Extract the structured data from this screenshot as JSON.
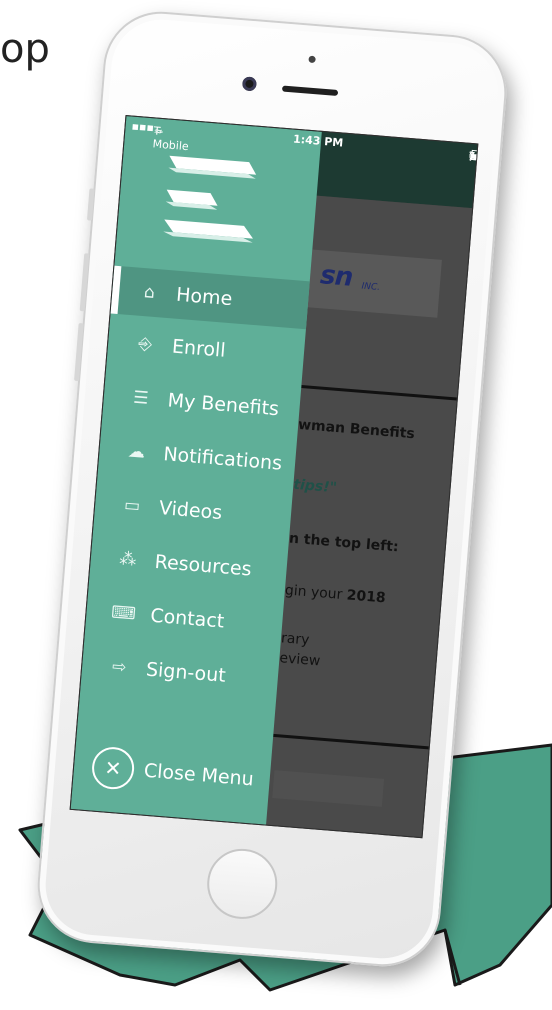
{
  "background": {
    "cropped_text": "op"
  },
  "status_bar": {
    "carrier": "T-Mobile",
    "time": "1:43 PM",
    "battery": "78%"
  },
  "drawer": {
    "items": [
      {
        "label": "Home",
        "icon": "home-icon"
      },
      {
        "label": "Enroll",
        "icon": "enroll-icon"
      },
      {
        "label": "My Benefits",
        "icon": "benefits-list-icon"
      },
      {
        "label": "Notifications",
        "icon": "notifications-icon"
      },
      {
        "label": "Videos",
        "icon": "video-icon"
      },
      {
        "label": "Resources",
        "icon": "resources-icon"
      },
      {
        "label": "Contact",
        "icon": "contact-icon"
      },
      {
        "label": "Sign-out",
        "icon": "sign-out-icon"
      }
    ],
    "close_label": "Close Menu",
    "active_index": 0
  },
  "app_content": {
    "logo_suffix": "INC.",
    "heading": "wman Benefits",
    "tips": "tips!\"",
    "top_left": "n the top left:",
    "begin_prefix": "gin your ",
    "begin_year": "2018",
    "library": "rary",
    "review": "eview"
  },
  "colors": {
    "drawer_bg": "#5faf98",
    "drawer_active": "#4f9582",
    "ribbon": "#4b9f86",
    "app_header": "#1d3a32"
  }
}
